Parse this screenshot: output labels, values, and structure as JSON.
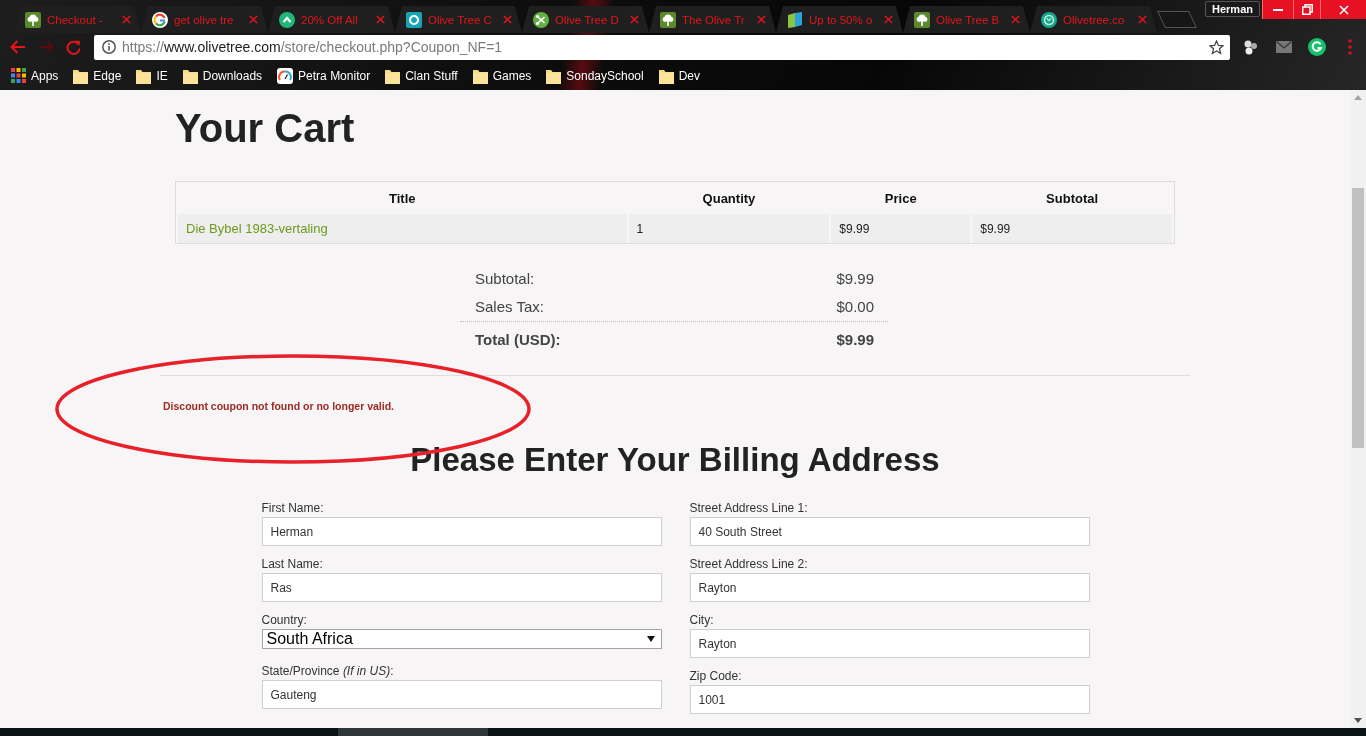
{
  "browser": {
    "tabs": [
      {
        "title": "Checkout -"
      },
      {
        "title": "get olive tre"
      },
      {
        "title": "20% Off All"
      },
      {
        "title": "Olive Tree C"
      },
      {
        "title": "Olive Tree D"
      },
      {
        "title": "The Olive Tr"
      },
      {
        "title": "Up to 50% o"
      },
      {
        "title": "Olive Tree B"
      },
      {
        "title": "Olivetree.co"
      }
    ],
    "profile": "Herman",
    "url": {
      "scheme": "https://",
      "host": "www.olivetree.com",
      "path": "/store/checkout.php?Coupon_NF=1"
    },
    "bookmarks": [
      {
        "label": "Apps",
        "kind": "apps"
      },
      {
        "label": "Edge",
        "kind": "folder"
      },
      {
        "label": "IE",
        "kind": "folder"
      },
      {
        "label": "Downloads",
        "kind": "folder"
      },
      {
        "label": "Petra Monitor",
        "kind": "site"
      },
      {
        "label": "Clan Stuff",
        "kind": "folder"
      },
      {
        "label": "Games",
        "kind": "folder"
      },
      {
        "label": "SondaySchool",
        "kind": "folder"
      },
      {
        "label": "Dev",
        "kind": "folder"
      }
    ]
  },
  "page": {
    "title": "Your Cart",
    "cart": {
      "columns": [
        "Title",
        "Quantity",
        "Price",
        "Subtotal"
      ],
      "rows": [
        {
          "title": "Die Bybel 1983-vertaling",
          "quantity": "1",
          "price": "$9.99",
          "subtotal": "$9.99"
        }
      ]
    },
    "totals": [
      {
        "label": "Subtotal:",
        "value": "$9.99",
        "kind": "line"
      },
      {
        "label": "Sales Tax:",
        "value": "$0.00",
        "kind": "line"
      },
      {
        "label": "Total (USD):",
        "value": "$9.99",
        "kind": "total"
      }
    ],
    "coupon_error": "Discount coupon not found or no longer valid.",
    "billing": {
      "heading": "Please Enter Your Billing Address",
      "left": [
        {
          "label": "First Name:",
          "value": "Herman",
          "kind": "text"
        },
        {
          "label": "Last Name:",
          "value": "Ras",
          "kind": "text"
        },
        {
          "label": "Country:",
          "value": "South Africa",
          "kind": "select"
        },
        {
          "label": "State/Province *(If in US)*:",
          "value": "Gauteng",
          "kind": "text"
        }
      ],
      "right": [
        {
          "label": "Street Address Line 1:",
          "value": "40 South Street",
          "kind": "text"
        },
        {
          "label": "Street Address Line 2:",
          "value": "Rayton",
          "kind": "text"
        },
        {
          "label": "City:",
          "value": "Rayton",
          "kind": "text"
        },
        {
          "label": "Zip Code:",
          "value": "1001",
          "kind": "text"
        }
      ]
    }
  }
}
